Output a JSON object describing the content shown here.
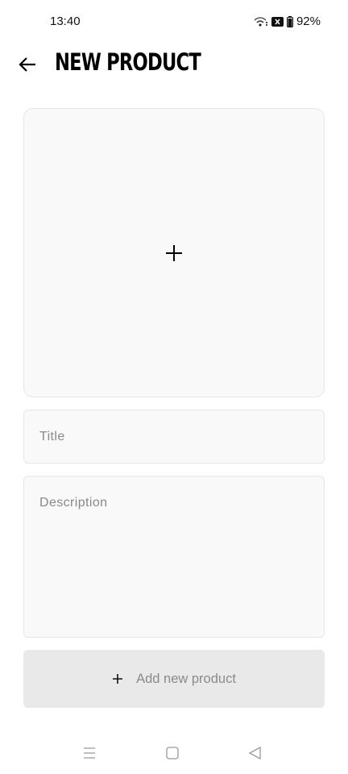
{
  "status_bar": {
    "time": "13:40",
    "battery": "92%"
  },
  "header": {
    "title": "NEW PRODUCT"
  },
  "form": {
    "title_placeholder": "Title",
    "description_placeholder": "Description"
  },
  "button": {
    "label": "Add new product"
  }
}
